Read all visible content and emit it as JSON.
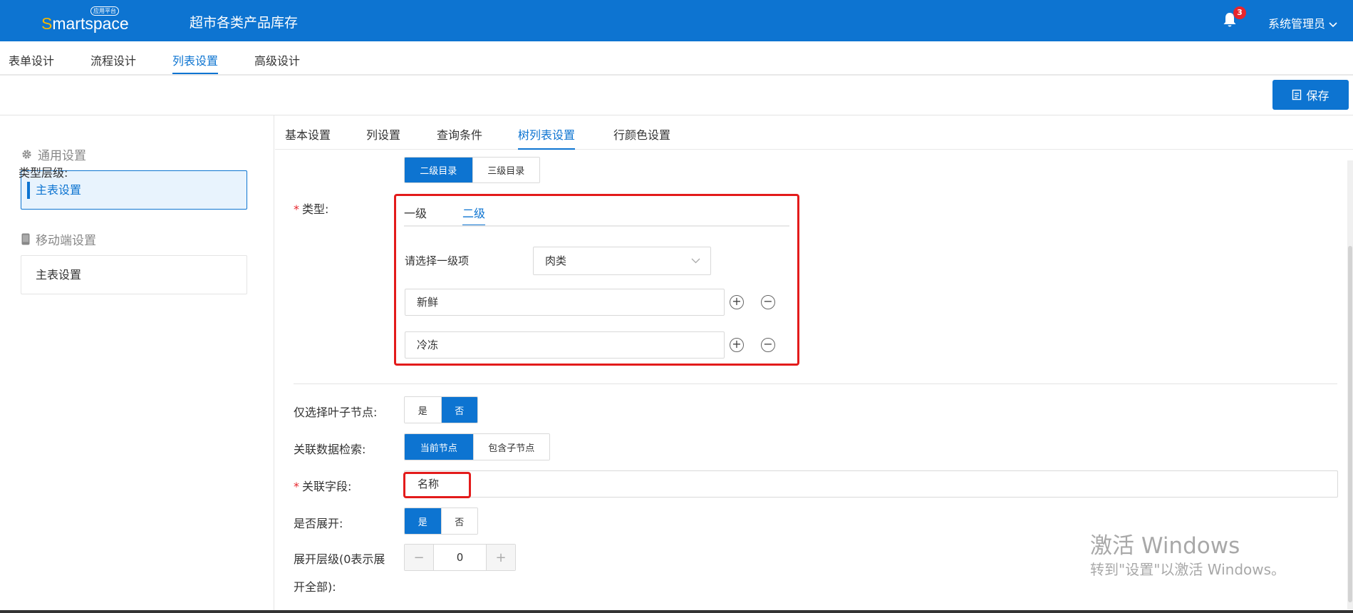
{
  "header": {
    "logo_prefix": "S",
    "logo_rest": "martspace",
    "logo_badge": "应用平台",
    "app_title": "超市各类产品库存",
    "notification_count": "3",
    "user_label": "系统管理员"
  },
  "design_tabs": [
    {
      "label": "表单设计"
    },
    {
      "label": "流程设计"
    },
    {
      "label": "列表设置"
    },
    {
      "label": "高级设计"
    }
  ],
  "toolbar": {
    "save_label": "保存"
  },
  "left_panel": {
    "general_title": "通用设置",
    "general_item": "主表设置",
    "mobile_title": "移动端设置",
    "mobile_item": "主表设置"
  },
  "sub_tabs": [
    {
      "label": "基本设置"
    },
    {
      "label": "列设置"
    },
    {
      "label": "查询条件"
    },
    {
      "label": "树列表设置"
    },
    {
      "label": "行颜色设置"
    }
  ],
  "form": {
    "type_level_label": "类型层级:",
    "type_level_options": [
      "二级目录",
      "三级目录"
    ],
    "type_label": "类型:",
    "type_tabs": [
      "一级",
      "二级"
    ],
    "select_first_label": "请选择一级项",
    "select_first_value": "肉类",
    "items": [
      "新鲜",
      "冷冻"
    ],
    "leaf_only_label": "仅选择叶子节点:",
    "leaf_only_options": [
      "是",
      "否"
    ],
    "related_search_label": "关联数据检索:",
    "related_search_options": [
      "当前节点",
      "包含子节点"
    ],
    "related_field_label": "关联字段:",
    "related_field_value": "名称",
    "expand_label": "是否展开:",
    "expand_options": [
      "是",
      "否"
    ],
    "expand_level_label_1": "展开层级(0表示展",
    "expand_level_label_2": "开全部):",
    "expand_level_value": "0"
  },
  "watermark": {
    "line1": "激活 Windows",
    "line2": "转到\"设置\"以激活 Windows。"
  },
  "colors": {
    "primary": "#0d74d1",
    "highlight_border": "#e31b1b",
    "badge": "#e7262d"
  }
}
